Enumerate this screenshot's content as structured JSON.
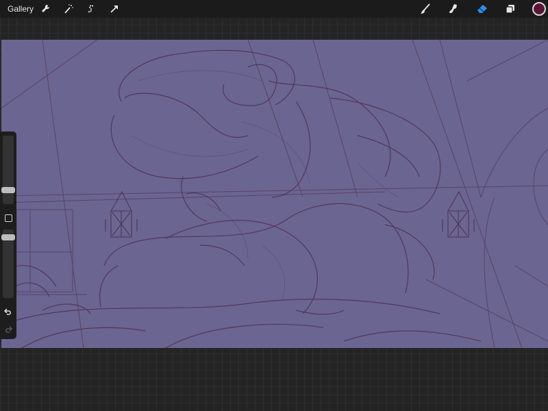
{
  "topbar": {
    "gallery_label": "Gallery",
    "left_tools": [
      {
        "name": "wrench-icon"
      },
      {
        "name": "magic-wand-icon"
      },
      {
        "name": "selection-s-icon"
      },
      {
        "name": "transform-arrow-icon"
      }
    ],
    "right_tools": [
      {
        "name": "brush-icon"
      },
      {
        "name": "smudge-icon",
        "active": false
      },
      {
        "name": "eraser-icon",
        "active": true
      },
      {
        "name": "layers-icon"
      }
    ],
    "current_color": "#5a1535"
  },
  "colors": {
    "canvas_bg": "#6b6591",
    "sketch_line": "#4a2748",
    "accent_active": "#2b8ff0"
  },
  "sidebar": {
    "size_slider_icon": "size-slider",
    "opacity_slider_icon": "opacity-slider",
    "modify_icon": "square-icon",
    "undo_icon": "undo-icon",
    "redo_icon": "redo-icon"
  }
}
